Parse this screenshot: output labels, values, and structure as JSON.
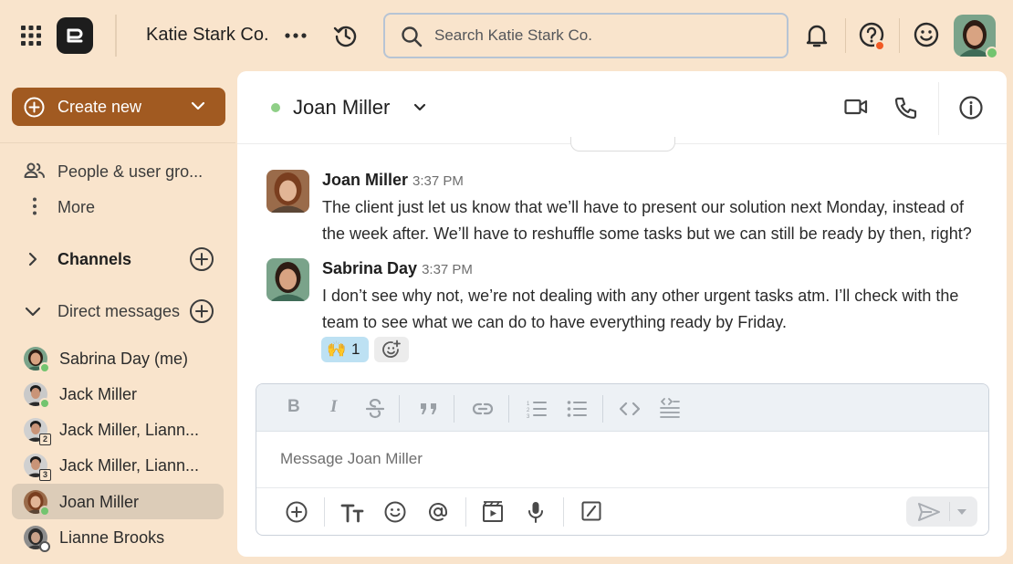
{
  "topbar": {
    "workspace_name": "Katie Stark Co.",
    "search_placeholder": "Search Katie Stark Co."
  },
  "sidebar": {
    "create_label": "Create new",
    "items": [
      {
        "label": "People & user gro...",
        "icon": "people-icon"
      },
      {
        "label": "More",
        "icon": "kebab-icon"
      }
    ],
    "channels_label": "Channels",
    "direct_messages_label": "Direct messages",
    "direct_messages": [
      {
        "label": "Sabrina Day (me)",
        "status": "online"
      },
      {
        "label": "Jack Miller",
        "status": "online"
      },
      {
        "label": "Jack Miller, Liann...",
        "group_count": "2"
      },
      {
        "label": "Jack Miller, Liann...",
        "group_count": "3"
      },
      {
        "label": "Joan Miller",
        "status": "online",
        "active": true
      },
      {
        "label": "Lianne Brooks",
        "status": "away"
      }
    ]
  },
  "conversation": {
    "name": "Joan Miller",
    "status_color": "#8fcf87",
    "messages": [
      {
        "author": "Joan Miller",
        "time": "3:37 PM",
        "text": "The client just let us know that we’ll have to present our solution next Monday, instead of the week after. We’ll have to reshuffle some tasks but we can still be ready by then, right?"
      },
      {
        "author": "Sabrina Day",
        "time": "3:37 PM",
        "text": "I don’t see why not, we’re not dealing with any other urgent tasks atm. I’ll check with the team to see what we can do to have everything ready by Friday.",
        "reaction": {
          "emoji": "🙌",
          "count": "1"
        }
      }
    ]
  },
  "composer": {
    "placeholder": "Message Joan Miller",
    "format_buttons": [
      "bold",
      "italic",
      "strikethrough",
      "quote",
      "link",
      "numbered-list",
      "bulleted-list",
      "code",
      "code-block"
    ],
    "tool_buttons": [
      "add",
      "text-format",
      "emoji",
      "mention",
      "video-clip",
      "microphone",
      "slash-command"
    ]
  },
  "colors": {
    "background": "#f9e4cc",
    "accent": "#a15a21",
    "online": "#73c46f",
    "notification": "#f15a24"
  }
}
